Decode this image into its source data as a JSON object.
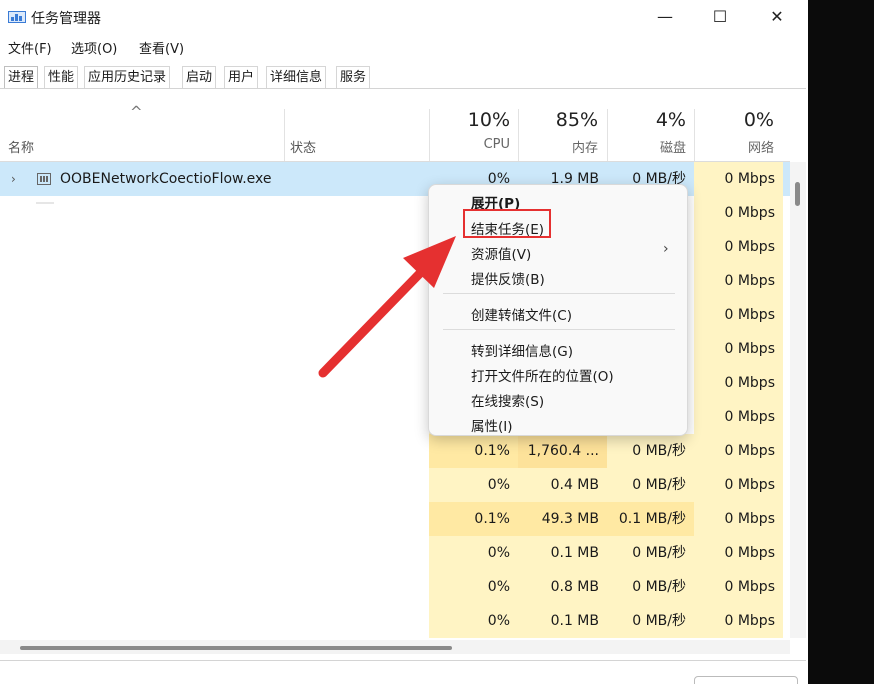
{
  "window": {
    "title": "任务管理器",
    "minimize": "—",
    "maximize": "☐",
    "close": "✕"
  },
  "menu": {
    "file": "文件(F)",
    "options": "选项(O)",
    "view": "查看(V)"
  },
  "tabs": [
    "进程",
    "性能",
    "应用历史记录",
    "启动",
    "用户",
    "详细信息",
    "服务"
  ],
  "header": {
    "sort_glyph": "^",
    "name": "名称",
    "status": "状态",
    "cpu": {
      "pct": "10%",
      "label": "CPU"
    },
    "memory": {
      "pct": "85%",
      "label": "内存"
    },
    "disk": {
      "pct": "4%",
      "label": "磁盘"
    },
    "network": {
      "pct": "0%",
      "label": "网络"
    }
  },
  "selected_process": {
    "expand": "›",
    "name": "OOBENetworkCoectioFlow.exe",
    "cpu": "0%",
    "memory": "1.9 MB",
    "disk": "0 MB/秒",
    "network": "0 Mbps"
  },
  "rows": [
    {
      "network": "0 Mbps"
    },
    {
      "network": "0 Mbps"
    },
    {
      "network": "0 Mbps"
    },
    {
      "network": "0 Mbps"
    },
    {
      "network": "0 Mbps"
    },
    {
      "network": "0 Mbps"
    },
    {
      "network": "0 Mbps"
    },
    {
      "cpu": "0.1%",
      "memory": "1,760.4 ...",
      "disk": "0 MB/秒",
      "network": "0 Mbps"
    },
    {
      "cpu": "0%",
      "memory": "0.4 MB",
      "disk": "0 MB/秒",
      "network": "0 Mbps"
    },
    {
      "cpu": "0.1%",
      "memory": "49.3 MB",
      "disk": "0.1 MB/秒",
      "network": "0 Mbps"
    },
    {
      "cpu": "0%",
      "memory": "0.1 MB",
      "disk": "0 MB/秒",
      "network": "0 Mbps"
    },
    {
      "cpu": "0%",
      "memory": "0.8 MB",
      "disk": "0 MB/秒",
      "network": "0 Mbps"
    },
    {
      "cpu": "0%",
      "memory": "0.1 MB",
      "disk": "0 MB/秒",
      "network": "0 Mbps"
    }
  ],
  "context_menu": {
    "expand": "展开(P)",
    "end_task": "结束任务(E)",
    "resource_values": "资源值(V)",
    "submenu_chevron": "›",
    "feedback": "提供反馈(B)",
    "create_dump": "创建转储文件(C)",
    "go_to_details": "转到详细信息(G)",
    "open_file_location": "打开文件所在的位置(O)",
    "search_online": "在线搜索(S)",
    "properties": "属性(I)"
  },
  "colors": {
    "selected_row": "#cce8fa",
    "heat_light": "#fff4c4",
    "heat_mid": "#ffe9a3",
    "heat_strong": "#fde29a",
    "annotation_red": "#e53030"
  }
}
